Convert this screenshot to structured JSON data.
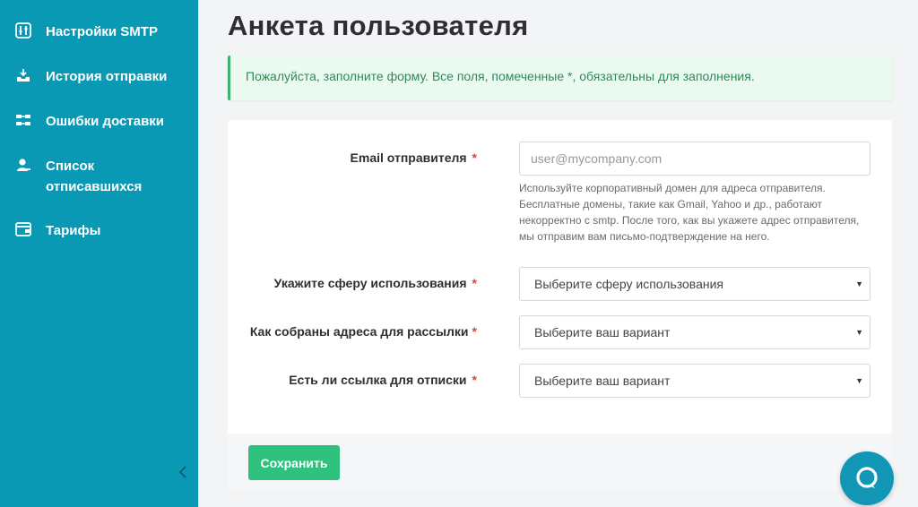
{
  "sidebar": {
    "items": [
      {
        "label": "Настройки SMTP",
        "icon": "sliders-icon"
      },
      {
        "label": "История отправки",
        "icon": "history-icon"
      },
      {
        "label": "Ошибки доставки",
        "icon": "errors-icon"
      },
      {
        "label": "Список отписавшихся",
        "icon": "user-icon"
      },
      {
        "label": "Тарифы",
        "icon": "wallet-icon"
      }
    ]
  },
  "page": {
    "title": "Анкета пользователя",
    "alert": "Пожалуйста, заполните форму. Все поля, помеченные *, обязательны для заполнения."
  },
  "form": {
    "email": {
      "label": "Email отправителя",
      "required_mark": "*",
      "placeholder": "user@mycompany.com",
      "value": "",
      "help": "Используйте корпоративный домен для адреса отправителя. Бесплатные домены, такие как Gmail, Yahoo и др., работают некорректно с smtp. После того, как вы укажете адрес отправителя, мы отправим вам письмо-подтверждение на него."
    },
    "usage": {
      "label": "Укажите сферу использования",
      "required_mark": "*",
      "selected": "Выберите сферу использования"
    },
    "collected": {
      "label": "Как собраны адреса для рассылки",
      "required_mark": "*",
      "selected": "Выберите ваш вариант"
    },
    "unsubscribe": {
      "label": "Есть ли ссылка для отписки",
      "required_mark": "*",
      "selected": "Выберите ваш вариант"
    },
    "save_label": "Сохранить"
  },
  "colors": {
    "sidebar": "#0a99b5",
    "accent_green": "#2ec27e",
    "required": "#e03e3e",
    "alert_text": "#2e8b57"
  }
}
